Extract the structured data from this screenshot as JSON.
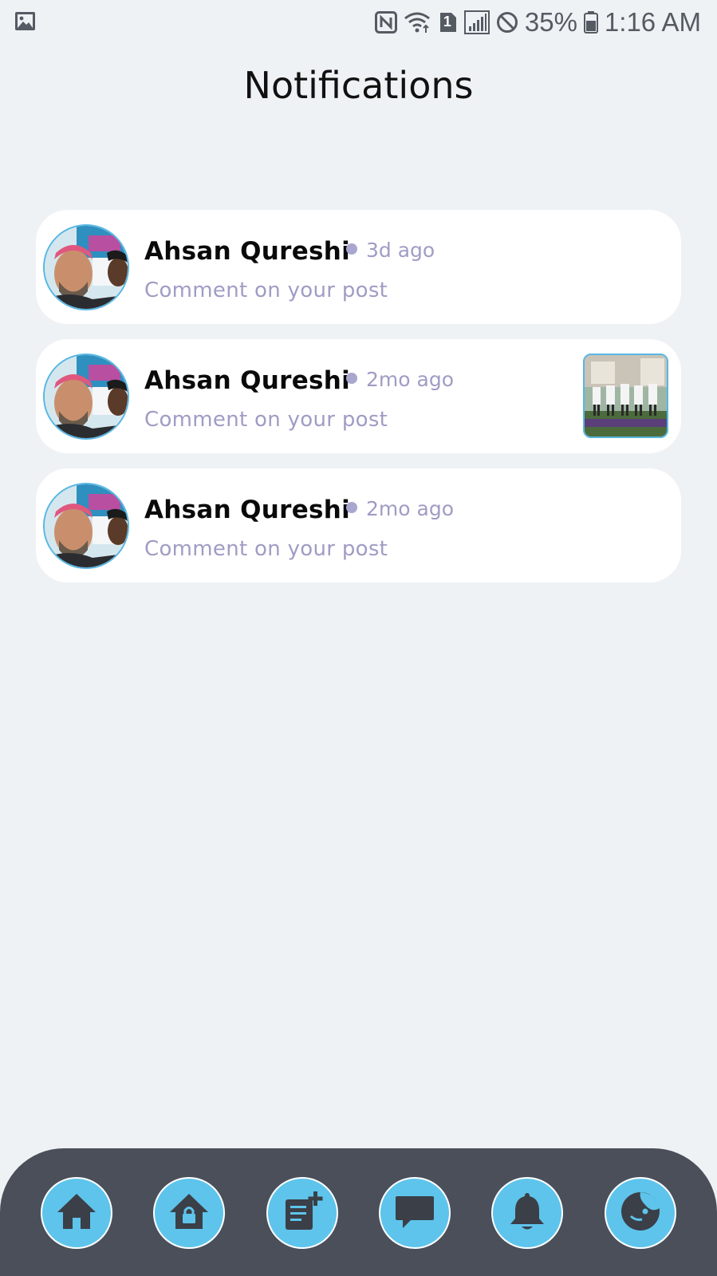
{
  "status_bar": {
    "battery_text": "35%",
    "time": "1:16 AM",
    "sim_badge": "1",
    "icons": [
      "gallery-icon",
      "nfc-icon",
      "wifi-icon",
      "signal-icon",
      "do-not-disturb-icon",
      "battery-icon"
    ]
  },
  "header": {
    "title": "Notifications"
  },
  "notifications": [
    {
      "name": "Ahsan Qureshi",
      "time": "3d ago",
      "message": "Comment on your post",
      "has_thumbnail": false
    },
    {
      "name": "Ahsan Qureshi",
      "time": "2mo ago",
      "message": "Comment on your post",
      "has_thumbnail": true
    },
    {
      "name": "Ahsan Qureshi",
      "time": "2mo ago",
      "message": "Comment on your post",
      "has_thumbnail": false
    }
  ],
  "bottom_nav": {
    "items": [
      "home-icon",
      "lock-home-icon",
      "add-post-icon",
      "chat-icon",
      "bell-icon",
      "profile-icon"
    ]
  },
  "colors": {
    "background": "#eff2f5",
    "card": "#ffffff",
    "accent": "#5ec4eb",
    "muted_text": "#a09cc4",
    "nav_bar": "#4a4f5a"
  }
}
